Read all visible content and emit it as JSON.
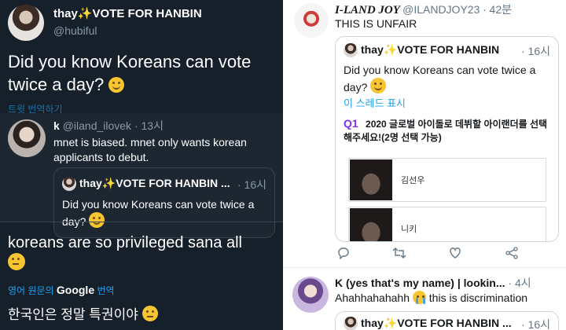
{
  "left_panel": {
    "main_tweet": {
      "name": "thay✨VOTE FOR HANBIN",
      "handle": "@hubiful",
      "text": "Did you know Koreans can vote twice a day?",
      "translate": "트윗 번역하기"
    },
    "reply": {
      "name": "k",
      "handle": "@iland_ilovek",
      "dot": "·",
      "time": "13시",
      "text": "mnet is biased. mnet only wants korean applicants to debut.",
      "quote": {
        "name": "thay✨VOTE FOR HANBIN ...",
        "dot": "·",
        "time": "16시",
        "text": "Did you know Koreans can vote twice a day?"
      }
    },
    "second_tweet": {
      "text": "koreans are so privileged sana all",
      "translate_prefix": "영어 원문의",
      "translate_brand": "Google",
      "translate_suffix": "번역",
      "korean_text": "한국인은 정말 특권이야"
    }
  },
  "right_panel": {
    "tweet1": {
      "name": "I-LAND JOY",
      "handle": "@ILANDJOY23",
      "dot": "·",
      "time": "42분",
      "text": "THIS IS UNFAIR",
      "quote": {
        "name": "thay✨VOTE FOR HANBIN",
        "dot": "·",
        "time": "16시",
        "text": "Did you know Koreans can vote twice a day?",
        "thread_link": "이 스레드 표시",
        "poll_label": "Q1",
        "poll_question": "2020 글로벌 아이돌로 데뷔할 아이랜더를 선택해주세요!(2명 선택 가능)",
        "options": [
          {
            "label": "김선우"
          },
          {
            "label": "니키"
          }
        ]
      },
      "actions": [
        "reply-icon",
        "retweet-icon",
        "like-icon",
        "share-icon"
      ]
    },
    "tweet2": {
      "name": "K (yes that's my name) | lookin...",
      "dot": "·",
      "time": "4시",
      "text": "Ahahhahahahh",
      "text_suffix": "this is discrimination",
      "quote": {
        "name": "thay✨VOTE FOR HANBIN ...",
        "dot": "·",
        "time": "16시"
      }
    }
  },
  "colors": {
    "dark_bg": "#15202b",
    "dark_reply_bg": "#1c2732",
    "link_blue": "#1da1f2",
    "muted_dark": "#8899a6",
    "muted_light": "#657786",
    "poll_purple": "#7b2ff7"
  }
}
